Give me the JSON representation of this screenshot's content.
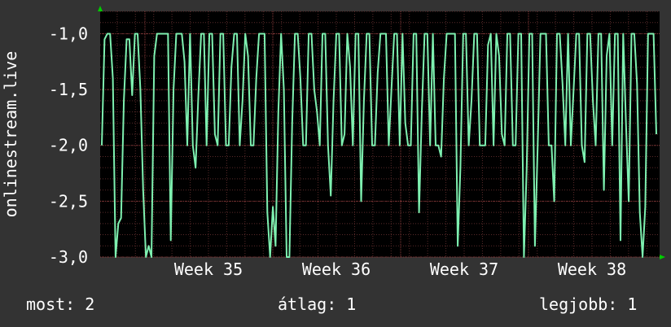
{
  "chart_data": {
    "type": "line",
    "title": "",
    "ylabel": "onlinestream.live",
    "xlabel": "",
    "ylim": [
      -3.0,
      -0.8
    ],
    "y_ticks": [
      "-1,0",
      "-1,5",
      "-2,0",
      "-2,5",
      "-3,0"
    ],
    "y_tick_values": [
      -1.0,
      -1.5,
      -2.0,
      -2.5,
      -3.0
    ],
    "x_ticks": [
      "Week 35",
      "Week 36",
      "Week 37",
      "Week 38"
    ],
    "grid": true,
    "background": "#000000",
    "frame_color": "#333333",
    "grid_color": "#5a2a2a",
    "axis_arrow_color": "#00cc00",
    "series": [
      {
        "color": "#7ef0b0",
        "values": [
          -2.0,
          -1.05,
          -1.0,
          -1.0,
          -1.4,
          -3.0,
          -2.7,
          -2.65,
          -1.6,
          -1.05,
          -1.05,
          -1.55,
          -1.0,
          -1.0,
          -1.5,
          -2.4,
          -3.0,
          -2.9,
          -3.0,
          -1.2,
          -1.0,
          -1.0,
          -1.0,
          -1.0,
          -1.0,
          -2.85,
          -1.5,
          -1.0,
          -1.0,
          -1.0,
          -1.25,
          -2.0,
          -1.0,
          -2.0,
          -2.2,
          -1.55,
          -1.0,
          -1.0,
          -2.0,
          -1.0,
          -1.0,
          -1.9,
          -2.0,
          -1.0,
          -1.0,
          -2.0,
          -2.0,
          -1.3,
          -1.0,
          -1.0,
          -2.0,
          -1.6,
          -1.0,
          -1.2,
          -2.0,
          -2.0,
          -1.4,
          -1.0,
          -1.0,
          -1.0,
          -2.6,
          -3.0,
          -2.55,
          -2.9,
          -1.7,
          -1.0,
          -1.5,
          -3.0,
          -3.0,
          -1.8,
          -1.0,
          -1.0,
          -1.4,
          -2.0,
          -2.0,
          -1.0,
          -1.0,
          -1.5,
          -1.7,
          -2.0,
          -1.0,
          -1.0,
          -2.0,
          -2.45,
          -1.6,
          -1.0,
          -1.0,
          -2.0,
          -1.9,
          -1.0,
          -1.3,
          -2.0,
          -1.0,
          -1.0,
          -2.5,
          -1.6,
          -1.0,
          -1.0,
          -2.0,
          -2.0,
          -1.35,
          -1.0,
          -1.0,
          -1.0,
          -2.0,
          -1.5,
          -1.0,
          -1.0,
          -2.0,
          -1.0,
          -1.8,
          -2.0,
          -2.0,
          -1.0,
          -1.0,
          -2.6,
          -1.7,
          -1.0,
          -1.0,
          -2.0,
          -1.0,
          -2.0,
          -2.0,
          -2.1,
          -1.4,
          -1.0,
          -1.0,
          -1.0,
          -1.0,
          -2.9,
          -2.2,
          -1.0,
          -1.0,
          -2.0,
          -1.6,
          -1.0,
          -1.0,
          -2.0,
          -2.0,
          -2.0,
          -1.1,
          -1.0,
          -2.0,
          -1.0,
          -1.2,
          -1.9,
          -2.0,
          -1.0,
          -1.0,
          -2.0,
          -2.0,
          -1.0,
          -1.0,
          -3.0,
          -2.2,
          -1.0,
          -1.0,
          -2.9,
          -2.0,
          -1.0,
          -1.0,
          -1.0,
          -2.0,
          -2.0,
          -2.5,
          -1.0,
          -1.0,
          -1.45,
          -2.0,
          -1.0,
          -2.0,
          -1.5,
          -1.0,
          -1.0,
          -2.0,
          -2.15,
          -1.0,
          -1.0,
          -1.6,
          -2.0,
          -1.0,
          -1.0,
          -2.4,
          -1.2,
          -1.0,
          -2.0,
          -1.0,
          -1.0,
          -2.85,
          -1.0,
          -1.8,
          -2.5,
          -1.0,
          -1.0,
          -1.45,
          -2.6,
          -3.0,
          -2.55,
          -1.0,
          -1.0,
          -1.0,
          -1.9
        ]
      }
    ]
  },
  "legend": {
    "now": "most: 2",
    "avg": "átlag: 1",
    "best": "legjobb: 1"
  }
}
